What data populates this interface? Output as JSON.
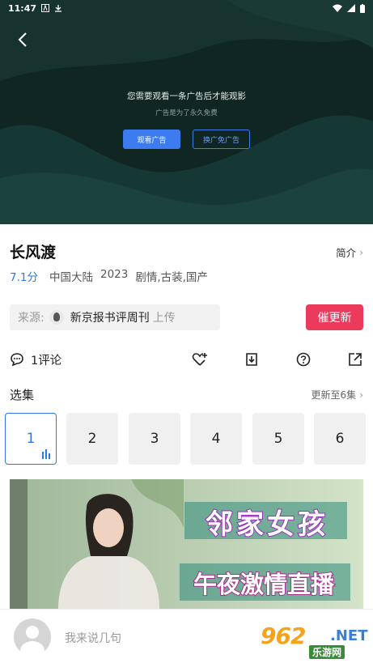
{
  "status_bar": {
    "time": "11:47"
  },
  "player": {
    "ad_message": "您需要观看一条广告后才能观影",
    "ad_subtext": "广告是为了永久免费",
    "watch_ad_label": "观看广告",
    "remove_ad_label": "换广免广告"
  },
  "video": {
    "title": "长风渡",
    "intro_label": "简介",
    "score": "7.1分",
    "region": "中国大陆",
    "year": "2023",
    "genres": "剧情,古装,国产"
  },
  "source": {
    "label": "来源:",
    "name": "新京报书评周刊",
    "suffix": "上传",
    "urge_button": "催更新"
  },
  "actions": {
    "comment_count": "1评论"
  },
  "episodes": {
    "section_title": "选集",
    "update_status": "更新至6集",
    "items": [
      "1",
      "2",
      "3",
      "4",
      "5",
      "6"
    ],
    "active_index": 0
  },
  "banner": {
    "line1": "邻家女孩",
    "line2": "午夜激情直播"
  },
  "composer": {
    "placeholder": "我来说几句"
  },
  "watermark": {
    "brand": "962",
    "domain": ".NET",
    "cn": "乐游网"
  },
  "colors": {
    "accent": "#2a7ae2",
    "urge": "#ec3a5d",
    "player_bg": "#0f2926"
  }
}
